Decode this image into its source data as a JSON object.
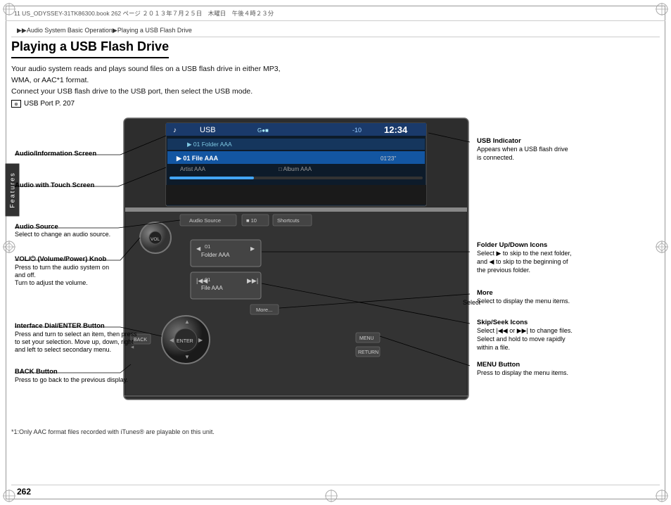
{
  "page": {
    "header_text": "11 US_ODYSSEY-31TK86300.book  262 ページ  ２０１３年７月２５日　木曜日　午後４時２３分",
    "breadcrumb": "▶▶Audio System Basic Operation▶Playing a USB Flash Drive",
    "title": "Playing a USB Flash Drive",
    "intro_lines": [
      "Your audio system reads and plays sound files on a USB flash drive in either MP3,",
      "WMA, or AAC*1 format.",
      "Connect your USB flash drive to the USB port, then select the USB mode."
    ],
    "usb_port_ref": "USB Port P. 207",
    "page_number": "262",
    "footer_note": "*1:Only AAC format files recorded with iTunes® are playable on this unit."
  },
  "screen": {
    "label": "USB",
    "signal": "G●■",
    "time": "12:34",
    "volume": "-10",
    "track1": "▶ 01  Folder AAA",
    "track2": "▶ 01 File AAA",
    "elapsed": "01'23\"",
    "artist": "Artist AAA",
    "album": "Album AAA"
  },
  "annotations": {
    "left": [
      {
        "id": "audio-info-screen",
        "title": "Audio/Information Screen",
        "desc": ""
      },
      {
        "id": "audio-touch-screen",
        "title": "Audio with Touch Screen",
        "desc": ""
      },
      {
        "id": "audio-source",
        "title": "Audio Source",
        "desc": "Select to change an audio source."
      },
      {
        "id": "vol-knob",
        "title": "VOL/⏻ (Volume/Power) Knob",
        "desc": "Press to turn the audio system on\nand off.\nTurn to adjust the volume."
      },
      {
        "id": "interface-dial",
        "title": "Interface Dial/ENTER Button",
        "desc": "Press and turn to select an item, then press\nto set your selection. Move up, down, right\nand left to select secondary menu."
      },
      {
        "id": "back-button",
        "title": "BACK Button",
        "desc": "Press to go back to the previous display."
      }
    ],
    "right": [
      {
        "id": "usb-indicator",
        "title": "USB Indicator",
        "desc": "Appears when a USB flash drive\nis connected."
      },
      {
        "id": "folder-icons",
        "title": "Folder Up/Down Icons",
        "desc": "Select ▶ to skip to the next folder,\nand ◀ to skip to the beginning of\nthe previous folder."
      },
      {
        "id": "more",
        "title": "More",
        "desc": "Select to display the menu items."
      },
      {
        "id": "skip-seek",
        "title": "Skip/Seek Icons",
        "desc": "Select |◀◀ or ▶▶| to change files.\nSelect and hold to move rapidly\nwithin a file."
      },
      {
        "id": "menu-button",
        "title": "MENU Button",
        "desc": "Press to display the menu items."
      }
    ]
  },
  "buttons": {
    "audio_source": "Audio Source",
    "ten_label": "■ 10",
    "shortcuts": "Shortcuts",
    "folder_aaa": "Folder AAA",
    "file_aaa": "File AAA",
    "more": "More...",
    "enter": "ENTER",
    "back": "BACK",
    "menu": "MENU",
    "return": "RETURN"
  }
}
